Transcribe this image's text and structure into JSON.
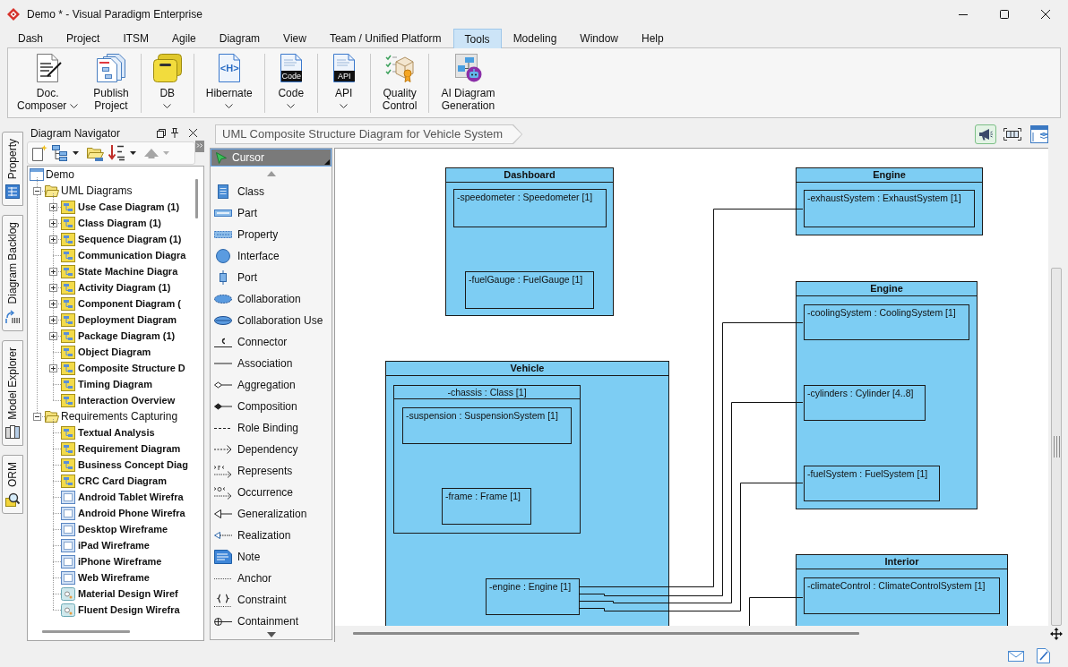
{
  "window": {
    "title": "Demo * - Visual Paradigm Enterprise"
  },
  "menu_tabs": [
    {
      "label": "Dash",
      "selected": false
    },
    {
      "label": "Project",
      "selected": false
    },
    {
      "label": "ITSM",
      "selected": false
    },
    {
      "label": "Agile",
      "selected": false
    },
    {
      "label": "Diagram",
      "selected": false
    },
    {
      "label": "View",
      "selected": false
    },
    {
      "label": "Team / Unified Platform",
      "selected": false
    },
    {
      "label": "Tools",
      "selected": true
    },
    {
      "label": "Modeling",
      "selected": false
    },
    {
      "label": "Window",
      "selected": false
    },
    {
      "label": "Help",
      "selected": false
    }
  ],
  "ribbon": [
    {
      "kind": "composer",
      "label_lines": [
        "Doc.",
        "Composer"
      ],
      "dropdown": true,
      "separator_before": false
    },
    {
      "kind": "publish",
      "label_lines": [
        "Publish",
        "Project"
      ],
      "dropdown": false,
      "separator_before": false
    },
    {
      "kind": "database",
      "label_lines": [
        "DB"
      ],
      "dropdown": true,
      "separator_before": true
    },
    {
      "kind": "hibernate",
      "label_lines": [
        "Hibernate"
      ],
      "icon_text": "<H>",
      "dropdown": true,
      "separator_before": true
    },
    {
      "kind": "code",
      "label_lines": [
        "Code"
      ],
      "icon_text": "Code",
      "dropdown": true,
      "separator_before": true
    },
    {
      "kind": "api",
      "label_lines": [
        "API"
      ],
      "icon_text": "API",
      "dropdown": true,
      "separator_before": true
    },
    {
      "kind": "quality",
      "label_lines": [
        "Quality",
        "Control"
      ],
      "dropdown": false,
      "separator_before": true
    },
    {
      "kind": "ai",
      "label_lines": [
        "AI Diagram",
        "Generation"
      ],
      "dropdown": false,
      "separator_before": true
    }
  ],
  "side_tabs": [
    {
      "kind": "property",
      "label": "Property"
    },
    {
      "kind": "backlog",
      "label": "Diagram Backlog"
    },
    {
      "kind": "explorer",
      "label": "Model Explorer"
    },
    {
      "kind": "orm",
      "label": "ORM"
    }
  ],
  "navigator": {
    "title": "Diagram Navigator",
    "tree": [
      {
        "label": "Demo",
        "kind": "project",
        "toggle": false,
        "children": [
          {
            "label": "UML Diagrams",
            "kind": "folder",
            "toggle": true,
            "expanded": true,
            "children": [
              {
                "label": "Use Case Diagram (1)",
                "kind": "diagram",
                "toggle": true,
                "expanded": false
              },
              {
                "label": "Class Diagram (1)",
                "kind": "diagram",
                "toggle": true,
                "expanded": false
              },
              {
                "label": "Sequence Diagram (1)",
                "kind": "diagram",
                "toggle": true,
                "expanded": false
              },
              {
                "label": "Communication Diagra",
                "kind": "diagram",
                "toggle": false
              },
              {
                "label": "State Machine Diagra",
                "kind": "diagram",
                "toggle": true,
                "expanded": false
              },
              {
                "label": "Activity Diagram (1)",
                "kind": "diagram",
                "toggle": true,
                "expanded": false
              },
              {
                "label": "Component Diagram (",
                "kind": "diagram",
                "toggle": true,
                "expanded": false
              },
              {
                "label": "Deployment Diagram",
                "kind": "diagram",
                "toggle": true,
                "expanded": false
              },
              {
                "label": "Package Diagram (1)",
                "kind": "diagram",
                "toggle": true,
                "expanded": false
              },
              {
                "label": "Object Diagram",
                "kind": "diagram",
                "toggle": false
              },
              {
                "label": "Composite Structure D",
                "kind": "diagram",
                "toggle": true,
                "expanded": false
              },
              {
                "label": "Timing Diagram",
                "kind": "diagram",
                "toggle": false
              },
              {
                "label": "Interaction Overview",
                "kind": "diagram",
                "toggle": false
              }
            ]
          },
          {
            "label": "Requirements Capturing",
            "kind": "folder",
            "toggle": true,
            "expanded": true,
            "children": [
              {
                "label": "Textual Analysis",
                "kind": "diagram",
                "toggle": false
              },
              {
                "label": "Requirement Diagram",
                "kind": "diagram",
                "toggle": false
              },
              {
                "label": "Business Concept Diag",
                "kind": "diagram",
                "toggle": false
              },
              {
                "label": "CRC Card Diagram",
                "kind": "diagram",
                "toggle": false
              },
              {
                "label": "Android Tablet Wirefra",
                "kind": "wireframe",
                "toggle": false
              },
              {
                "label": "Android Phone Wirefra",
                "kind": "wireframe",
                "toggle": false
              },
              {
                "label": "Desktop Wireframe",
                "kind": "wireframe",
                "toggle": false
              },
              {
                "label": "iPad Wireframe",
                "kind": "wireframe",
                "toggle": false
              },
              {
                "label": "iPhone Wireframe",
                "kind": "wireframe",
                "toggle": false
              },
              {
                "label": "Web Wireframe",
                "kind": "wireframe",
                "toggle": false
              },
              {
                "label": "Material Design Wiref",
                "kind": "design",
                "toggle": false
              },
              {
                "label": "Fluent Design Wirefra",
                "kind": "design",
                "toggle": false
              }
            ]
          }
        ]
      }
    ]
  },
  "palette": {
    "cursor": {
      "label": "Cursor",
      "selected": true
    },
    "items": [
      {
        "kind": "class",
        "label": "Class"
      },
      {
        "kind": "part",
        "label": "Part"
      },
      {
        "kind": "property",
        "label": "Property"
      },
      {
        "kind": "interface",
        "label": "Interface"
      },
      {
        "kind": "port",
        "label": "Port"
      },
      {
        "kind": "collaboration",
        "label": "Collaboration"
      },
      {
        "kind": "collabuse",
        "label": "Collaboration Use"
      },
      {
        "kind": "connector",
        "label": "Connector"
      },
      {
        "kind": "association",
        "label": "Association"
      },
      {
        "kind": "aggregation",
        "label": "Aggregation"
      },
      {
        "kind": "composition",
        "label": "Composition"
      },
      {
        "kind": "rolebinding",
        "label": "Role Binding"
      },
      {
        "kind": "dependency",
        "label": "Dependency"
      },
      {
        "kind": "represents",
        "label": "Represents"
      },
      {
        "kind": "occurrence",
        "label": "Occurrence"
      },
      {
        "kind": "generalization",
        "label": "Generalization"
      },
      {
        "kind": "realization",
        "label": "Realization"
      },
      {
        "kind": "note",
        "label": "Note"
      },
      {
        "kind": "anchor",
        "label": "Anchor"
      },
      {
        "kind": "constraint",
        "label": "Constraint"
      },
      {
        "kind": "containment",
        "label": "Containment"
      }
    ]
  },
  "editor": {
    "breadcrumb": "UML Composite Structure Diagram for Vehicle System",
    "toggles": [
      {
        "kind": "megaphone",
        "on": true
      },
      {
        "kind": "fit",
        "on": false
      },
      {
        "kind": "layers",
        "on": false
      }
    ],
    "diagram": {
      "classes": [
        {
          "name": "Dashboard",
          "parts": [
            {
              "label": "-speedometer : Speedometer [1]"
            },
            {
              "label": "-fuelGauge : FuelGauge [1]"
            }
          ]
        },
        {
          "name": "Engine",
          "parts": [
            {
              "label": "-exhaustSystem : ExhaustSystem [1]"
            }
          ]
        },
        {
          "name": "Engine",
          "parts": [
            {
              "label": "-coolingSystem : CoolingSystem [1]"
            },
            {
              "label": "-cylinders : Cylinder [4..8]"
            },
            {
              "label": "-fuelSystem : FuelSystem [1]"
            }
          ]
        },
        {
          "name": "Vehicle",
          "parts": [
            {
              "label": "-chassis : Class [1]",
              "parts": [
                {
                  "label": "-suspension : SuspensionSystem [1]"
                },
                {
                  "label": "-frame : Frame [1]"
                }
              ]
            },
            {
              "label": "-engine : Engine [1]"
            }
          ]
        },
        {
          "name": "Interior",
          "parts": [
            {
              "label": "-climateControl : ClimateControlSystem [1]"
            }
          ]
        }
      ]
    }
  }
}
